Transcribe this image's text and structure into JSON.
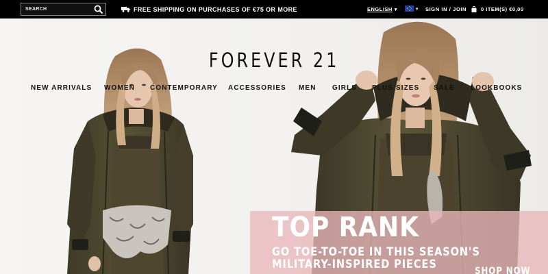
{
  "topbar": {
    "search_placeholder": "SEARCH",
    "promo": "FREE SHIPPING ON PURCHASES OF €75 OR MORE",
    "language": "ENGLISH",
    "language_caret": "▾",
    "flag_caret": "▾",
    "signin": "SIGN IN / JOIN",
    "cart": "0 ITEM(S)  €0,00"
  },
  "logo": "FOREVER 21",
  "nav": [
    "NEW ARRIVALS",
    "WOMEN",
    "CONTEMPORARY",
    "ACCESSORIES",
    "MEN",
    "GIRLS",
    "PLUS SIZES",
    "SALE",
    "LOOKBOOKS"
  ],
  "hero": {
    "title": "TOP RANK",
    "subtitle_line1": "GO TOE-TO-TOE IN THIS SEASON'S",
    "subtitle_line2": "MILITARY-INSPIRED PIECES",
    "cta": "SHOP NOW",
    "panel_color": "#e8b7ba"
  },
  "colors": {
    "topbar_bg": "#000000",
    "text": "#111111",
    "jacket": "#4a4430",
    "hair": "#c7a27a"
  }
}
